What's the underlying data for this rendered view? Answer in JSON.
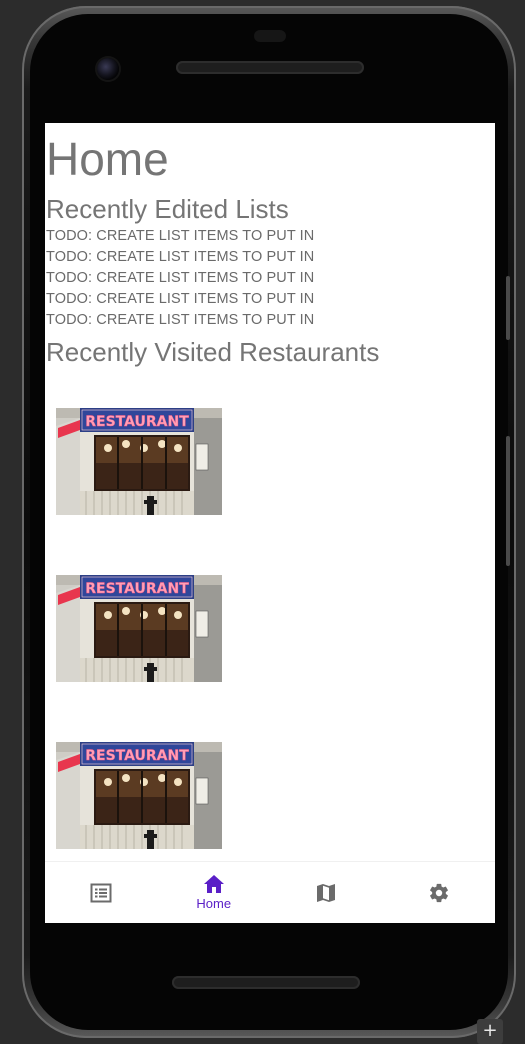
{
  "page": {
    "title": "Home"
  },
  "recent_lists": {
    "heading": "Recently Edited Lists",
    "items": [
      "TODO: CREATE LIST ITEMS TO PUT IN",
      "TODO: CREATE LIST ITEMS TO PUT IN",
      "TODO: CREATE LIST ITEMS TO PUT IN",
      "TODO: CREATE LIST ITEMS TO PUT IN",
      "TODO: CREATE LIST ITEMS TO PUT IN"
    ]
  },
  "recent_restaurants": {
    "heading": "Recently Visited Restaurants",
    "sign_text": "RESTAURANT",
    "items": [
      {
        "image": "restaurant-storefront-photo"
      },
      {
        "image": "restaurant-storefront-photo"
      },
      {
        "image": "restaurant-storefront-photo"
      }
    ]
  },
  "bottom_nav": {
    "items": [
      {
        "icon": "list-icon",
        "label": "",
        "active": false
      },
      {
        "icon": "home-icon",
        "label": "Home",
        "active": true
      },
      {
        "icon": "map-icon",
        "label": "",
        "active": false
      },
      {
        "icon": "settings-icon",
        "label": "",
        "active": false
      }
    ],
    "active_color": "#5a1fc7",
    "inactive_color": "#6b6b6b"
  },
  "emulator": {
    "plus_label": "+"
  }
}
